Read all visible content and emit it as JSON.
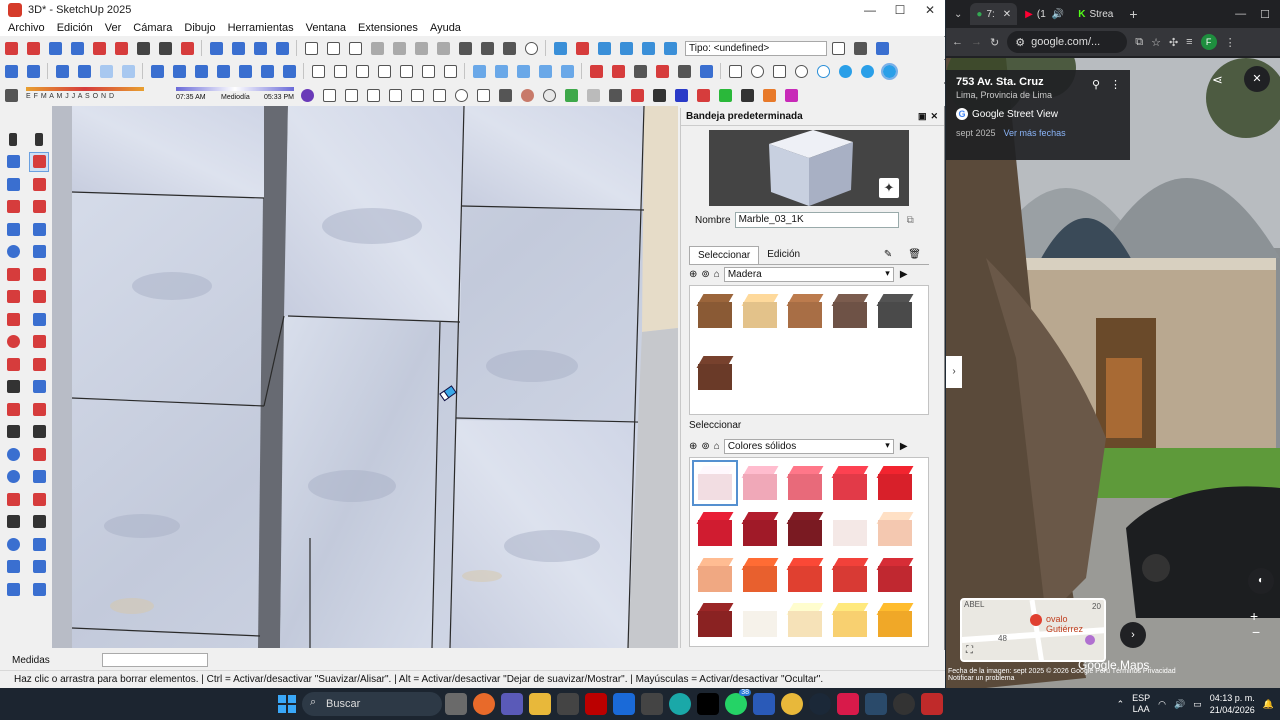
{
  "sketchup": {
    "title": "3D* - SketchUp 2025",
    "menu": [
      "Archivo",
      "Edición",
      "Ver",
      "Cámara",
      "Dibujo",
      "Herramientas",
      "Ventana",
      "Extensiones",
      "Ayuda"
    ],
    "type_label": "Tipo: <undefined>",
    "months": "E F M A M J J A S O N D",
    "time_start": "07:35 AM",
    "time_mid": "Mediodía",
    "time_end": "05:33 PM",
    "tray_title": "Bandeja predeterminada",
    "material_name_label": "Nombre",
    "material_name": "Marble_03_1K",
    "tab_select": "Seleccionar",
    "tab_edit": "Edición",
    "library1": "Madera",
    "section2_label": "Seleccionar",
    "library2": "Colores sólidos",
    "measures_label": "Medidas",
    "status": "Haz clic o arrastra para borrar elementos. | Ctrl = Activar/desactivar \"Suavizar/Alisar\". | Alt = Activar/desactivar \"Dejar de suavizar/Mostrar\". | Mayúsculas = Activar/desactivar \"Ocultar\".",
    "wood_colors": [
      "#8a5a35",
      "#e3c28a",
      "#a86e45",
      "#6e5246",
      "#4a4a4a",
      "#6a3a28"
    ],
    "solid_colors": [
      "#f2dde2",
      "#f0a8b8",
      "#e86a7a",
      "#e23a48",
      "#d8202a",
      "#d01c30",
      "#a01a28",
      "#7a1a22",
      "#f4e8e6",
      "#f4c8b0",
      "#f0a882",
      "#e8602e",
      "#e04030",
      "#d83a34",
      "#c02830",
      "#8a2222",
      "#f6f2ea",
      "#f6e2b8",
      "#f8d070",
      "#f0a828"
    ]
  },
  "chrome": {
    "tab1": "7:",
    "tab2": "(1",
    "tab3": "Strea",
    "url": "google.com/...",
    "address": "753 Av. Sta. Cruz",
    "city": "Lima, Provincia de Lima",
    "sv_label": "Google Street View",
    "date": "sept 2025",
    "more_dates": "Ver más fechas",
    "map_label": "ovalo Gutiérrez",
    "map_num1": "48",
    "map_num2": "20",
    "map_abel": "ABEL",
    "google_maps": "Google Maps",
    "footer": "Fecha de la imagen: sept 2025   © 2026 Google   Perú   Términos   Privacidad",
    "footer2": "Notificar un problema"
  },
  "taskbar": {
    "search": "Buscar",
    "lang1": "ESP",
    "lang2": "LAA",
    "time": "04:13 p. m.",
    "date": "21/04/2026",
    "badge": "38"
  }
}
